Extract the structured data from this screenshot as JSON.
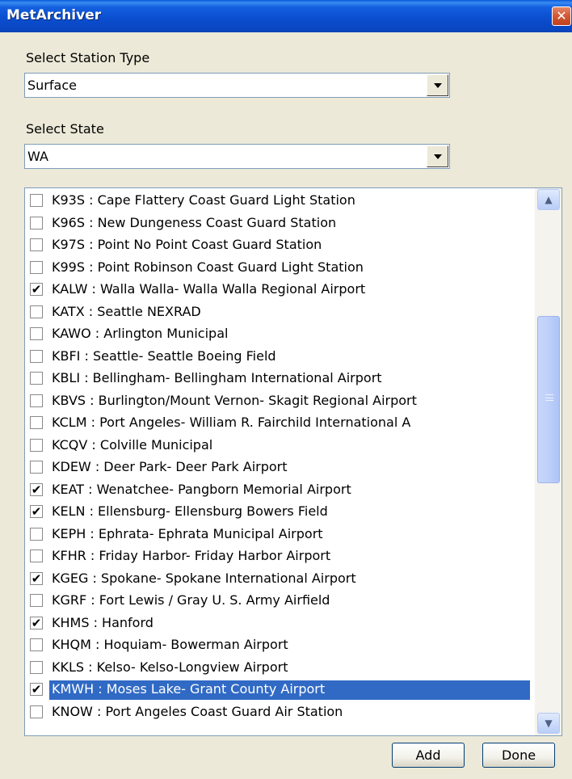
{
  "window": {
    "title": "MetArchiver",
    "close_glyph": "✕"
  },
  "station_type": {
    "label": "Select Station Type",
    "value": "Surface"
  },
  "state": {
    "label": "Select State",
    "value": "WA"
  },
  "stations": [
    {
      "text": "K93S : Cape Flattery Coast Guard Light Station",
      "checked": false,
      "selected": false
    },
    {
      "text": "K96S : New Dungeness Coast Guard Station",
      "checked": false,
      "selected": false
    },
    {
      "text": "K97S : Point No Point Coast Guard Station",
      "checked": false,
      "selected": false
    },
    {
      "text": "K99S : Point Robinson Coast Guard Light Station",
      "checked": false,
      "selected": false
    },
    {
      "text": "KALW : Walla Walla- Walla Walla Regional Airport",
      "checked": true,
      "selected": false
    },
    {
      "text": "KATX : Seattle NEXRAD",
      "checked": false,
      "selected": false
    },
    {
      "text": "KAWO : Arlington Municipal",
      "checked": false,
      "selected": false
    },
    {
      "text": "KBFI : Seattle- Seattle Boeing Field",
      "checked": false,
      "selected": false
    },
    {
      "text": "KBLI : Bellingham- Bellingham International Airport",
      "checked": false,
      "selected": false
    },
    {
      "text": "KBVS : Burlington/Mount Vernon- Skagit Regional Airport",
      "checked": false,
      "selected": false
    },
    {
      "text": "KCLM : Port Angeles- William R. Fairchild International A",
      "checked": false,
      "selected": false
    },
    {
      "text": "KCQV : Colville Municipal",
      "checked": false,
      "selected": false
    },
    {
      "text": "KDEW : Deer Park- Deer Park Airport",
      "checked": false,
      "selected": false
    },
    {
      "text": "KEAT : Wenatchee- Pangborn Memorial Airport",
      "checked": true,
      "selected": false
    },
    {
      "text": "KELN : Ellensburg- Ellensburg Bowers Field",
      "checked": true,
      "selected": false
    },
    {
      "text": "KEPH : Ephrata- Ephrata Municipal Airport",
      "checked": false,
      "selected": false
    },
    {
      "text": "KFHR : Friday Harbor- Friday Harbor Airport",
      "checked": false,
      "selected": false
    },
    {
      "text": "KGEG : Spokane- Spokane International Airport",
      "checked": true,
      "selected": false
    },
    {
      "text": "KGRF : Fort Lewis / Gray U. S. Army Airfield",
      "checked": false,
      "selected": false
    },
    {
      "text": "KHMS : Hanford",
      "checked": true,
      "selected": false
    },
    {
      "text": "KHQM : Hoquiam- Bowerman Airport",
      "checked": false,
      "selected": false
    },
    {
      "text": "KKLS : Kelso- Kelso-Longview Airport",
      "checked": false,
      "selected": false
    },
    {
      "text": "KMWH : Moses Lake- Grant County Airport",
      "checked": true,
      "selected": true
    },
    {
      "text": "KNOW : Port Angeles Coast Guard Air Station",
      "checked": false,
      "selected": false
    }
  ],
  "scrollbar": {
    "up_glyph": "▲",
    "down_glyph": "▼"
  },
  "buttons": {
    "add": "Add",
    "done": "Done"
  },
  "colors": {
    "title_bar": "#0a4fd0",
    "selection": "#316ac5",
    "window_bg": "#ece9d8"
  }
}
